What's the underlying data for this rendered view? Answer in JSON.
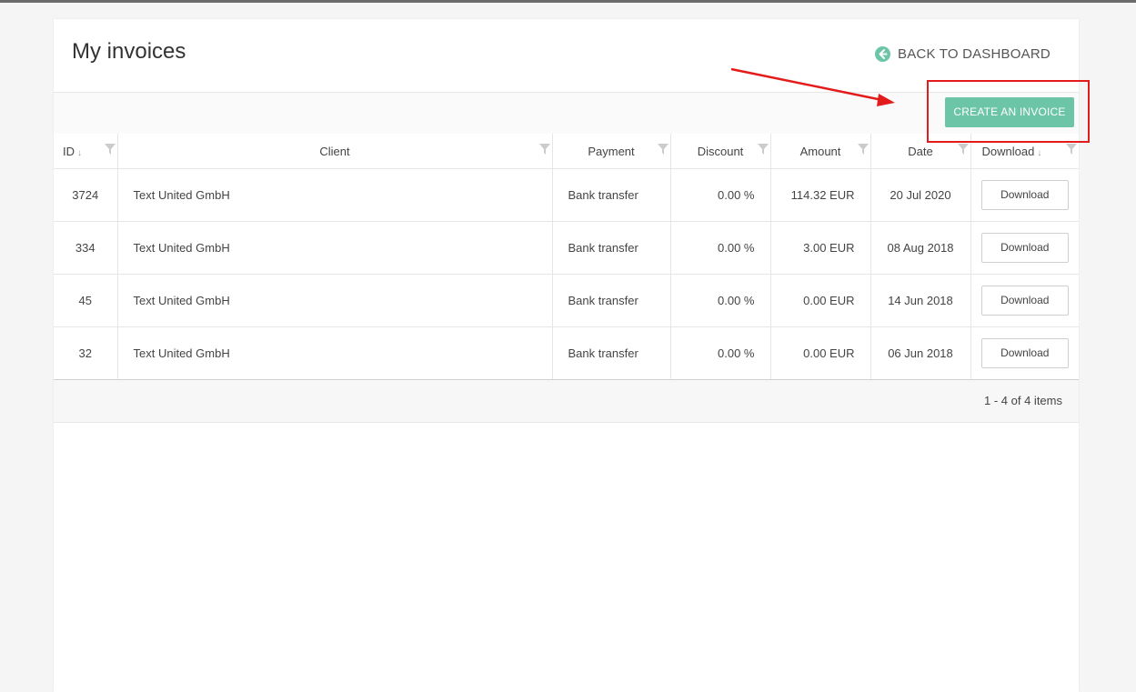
{
  "page": {
    "title": "My invoices",
    "back_label": "BACK TO DASHBOARD"
  },
  "toolbar": {
    "create_label": "CREATE AN INVOICE"
  },
  "table": {
    "columns": [
      "ID",
      "Client",
      "Payment",
      "Discount",
      "Amount",
      "Date",
      "Download"
    ],
    "rows": [
      {
        "id": "3724",
        "client": "Text United GmbH",
        "payment": "Bank transfer",
        "discount": "0.00 %",
        "amount": "114.32 EUR",
        "date": "20 Jul 2020",
        "download": "Download"
      },
      {
        "id": "334",
        "client": "Text United GmbH",
        "payment": "Bank transfer",
        "discount": "0.00 %",
        "amount": "3.00 EUR",
        "date": "08 Aug 2018",
        "download": "Download"
      },
      {
        "id": "45",
        "client": "Text United GmbH",
        "payment": "Bank transfer",
        "discount": "0.00 %",
        "amount": "0.00 EUR",
        "date": "14 Jun 2018",
        "download": "Download"
      },
      {
        "id": "32",
        "client": "Text United GmbH",
        "payment": "Bank transfer",
        "discount": "0.00 %",
        "amount": "0.00 EUR",
        "date": "06 Jun 2018",
        "download": "Download"
      }
    ]
  },
  "pager": {
    "info": "1 - 4 of 4 items"
  },
  "colors": {
    "accent": "#6cc5a7",
    "annotation": "#e31b1b"
  },
  "icons": {
    "back": "arrow-left-circle-icon",
    "filter": "filter-icon",
    "sort": "sort-down-icon"
  }
}
